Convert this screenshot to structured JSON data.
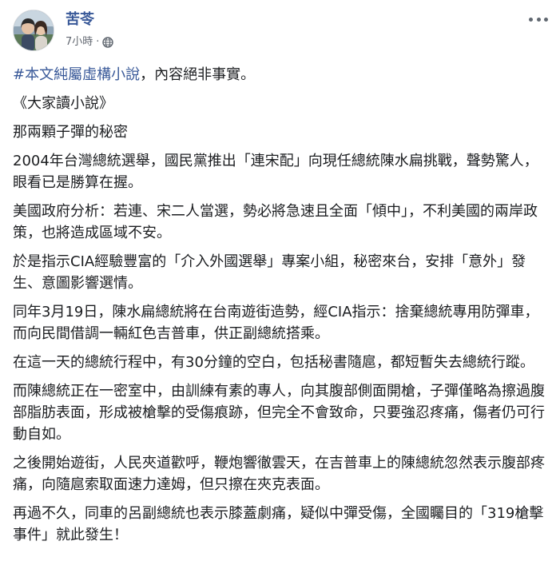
{
  "post": {
    "author": "苦苓",
    "timestamp": "7小時",
    "dot": "·",
    "audience_icon": "globe-icon",
    "more_icon": "more-options-icon",
    "hashtag": "#本文純屬虛構小說",
    "hashtag_suffix": "，內容絕非事實。",
    "paragraphs": [
      "《大家讀小說》",
      "那兩顆子彈的秘密",
      "2004年台灣總統選舉，國民黨推出「連宋配」向現任總統陳水扁挑戰，聲勢驚人，眼看已是勝算在握。",
      "美國政府分析：若連、宋二人當選，勢必將急速且全面「傾中」，不利美國的兩岸政策，也將造成區域不安。",
      "於是指示CIA經驗豐富的「介入外國選舉」專案小組，秘密來台，安排「意外」發生、意圖影響選情。",
      "同年3月19日，陳水扁總統將在台南遊街造勢，經CIA指示：捨棄總統專用防彈車，而向民間借調一輛紅色吉普車，供正副總統搭乘。",
      "在這一天的總統行程中，有30分鐘的空白，包括秘書隨扈，都短暫失去總統行蹤。",
      "而陳總統正在一密室中，由訓練有素的專人，向其腹部側面開槍，子彈僅略為擦過腹部脂肪表面，形成被槍擊的受傷痕跡，但完全不會致命，只要強忍疼痛，傷者仍可行動自如。",
      "之後開始遊街，人民夾道歡呼，鞭炮響徹雲天，在吉普車上的陳總統忽然表示腹部疼痛，向隨扈索取面速力達姆，但只擦在夾克表面。",
      "再過不久，同車的呂副總統也表示膝蓋劇痛，疑似中彈受傷，全國矚目的「319槍擊事件」就此發生！"
    ]
  },
  "colors": {
    "link": "#385898",
    "text": "#1c1e21",
    "meta": "#616770"
  }
}
